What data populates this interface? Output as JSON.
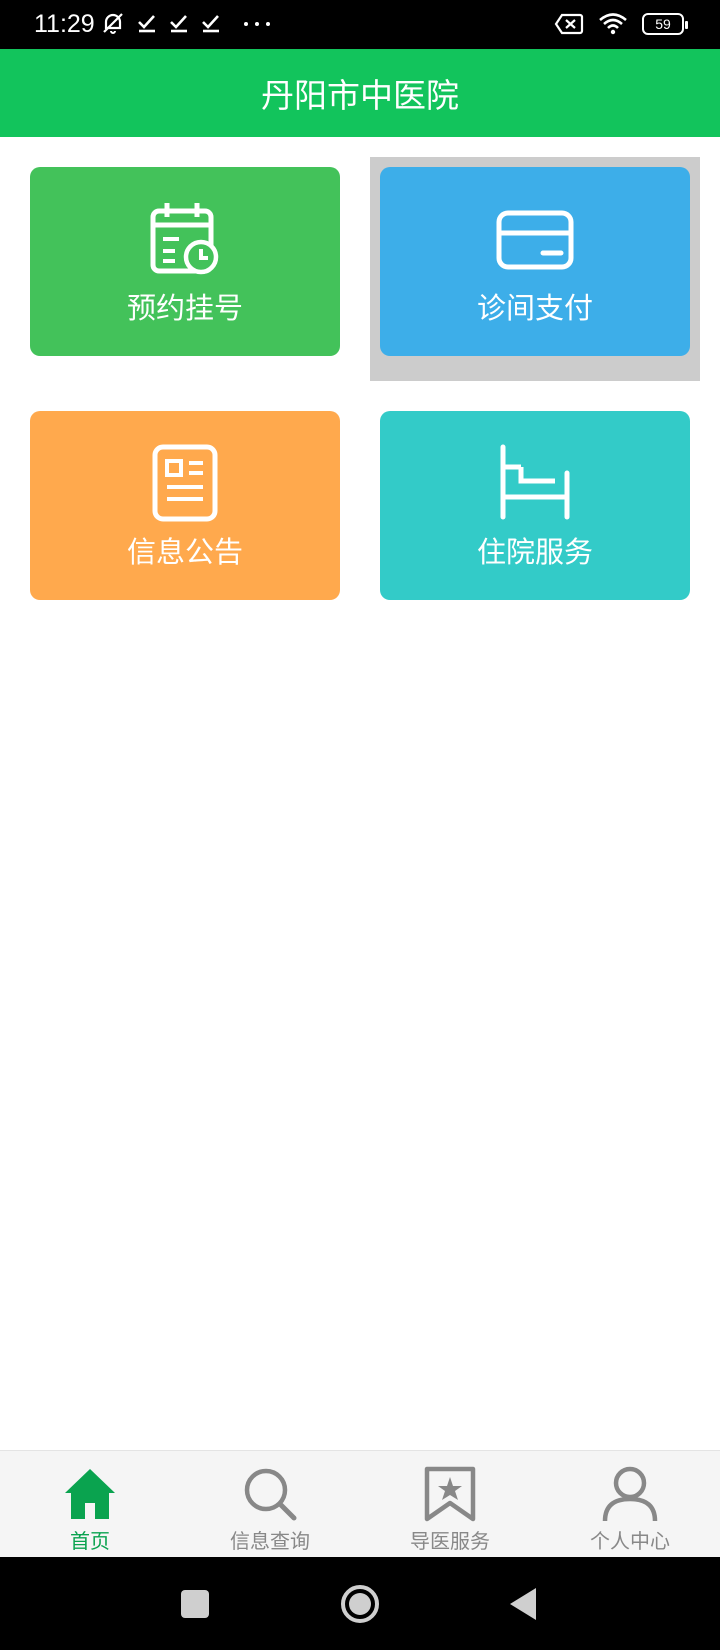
{
  "status_bar": {
    "time": "11:29",
    "battery": "59",
    "left_icons": [
      "mute-icon",
      "check-icon",
      "check-icon",
      "check-icon",
      "more-dots-icon"
    ],
    "right_icons": [
      "sim-off-icon",
      "wifi-icon",
      "battery-icon"
    ]
  },
  "header": {
    "title": "丹阳市中医院"
  },
  "tiles": [
    {
      "label": "预约挂号",
      "icon": "calendar-clock-icon",
      "color": "#43c25a"
    },
    {
      "label": "诊间支付",
      "icon": "card-icon",
      "color": "#3daee9"
    },
    {
      "label": "信息公告",
      "icon": "notice-icon",
      "color": "#ffa94d"
    },
    {
      "label": "住院服务",
      "icon": "bed-icon",
      "color": "#33cbc8"
    }
  ],
  "bottom_nav": [
    {
      "label": "首页",
      "icon": "home-icon",
      "active": true
    },
    {
      "label": "信息查询",
      "icon": "search-icon",
      "active": false
    },
    {
      "label": "导医服务",
      "icon": "bookmark-star-icon",
      "active": false
    },
    {
      "label": "个人中心",
      "icon": "user-icon",
      "active": false
    }
  ],
  "colors": {
    "primary": "#12c45c",
    "nav_active": "#0aa34f",
    "nav_inactive": "#888888"
  }
}
